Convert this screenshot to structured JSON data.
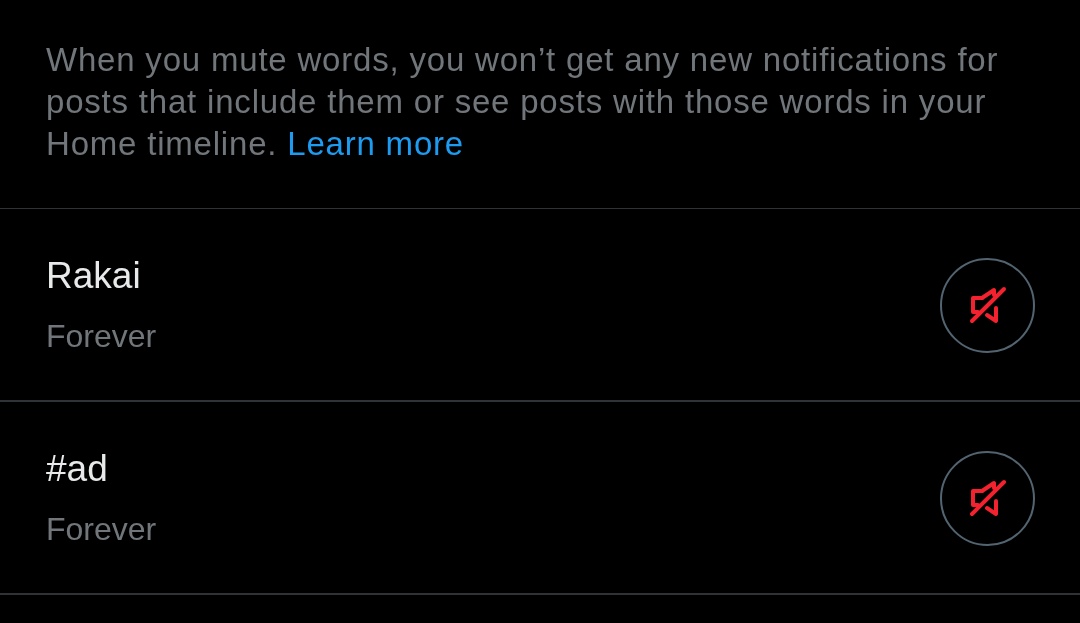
{
  "description": {
    "text": "When you mute words, you won’t get any new notifications for posts that include them or see posts with those words in your Home timeline.",
    "link": "Learn more"
  },
  "muted_words": [
    {
      "word": "Rakai",
      "duration": "Forever",
      "muted": true
    },
    {
      "word": "#ad",
      "duration": "Forever",
      "muted": true
    }
  ]
}
